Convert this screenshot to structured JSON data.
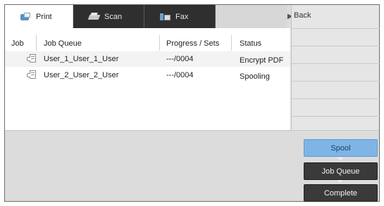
{
  "tabs": [
    {
      "label": "Print",
      "icon": "print-icon",
      "active": true
    },
    {
      "label": "Scan",
      "icon": "scan-icon",
      "active": false
    },
    {
      "label": "Fax",
      "icon": "fax-icon",
      "active": false
    }
  ],
  "side_panel": {
    "back_label": "Back",
    "arrow_icon": "play-arrow-icon"
  },
  "table": {
    "columns": [
      "Job",
      "Job Queue",
      "Progress / Sets",
      "Status"
    ],
    "rows": [
      {
        "icon": "job-document-icon",
        "name": "User_1_User_1_User",
        "progress": "---/0004",
        "status": "Encrypt PDF"
      },
      {
        "icon": "job-document-icon",
        "name": "User_2_User_2_User",
        "progress": "---/0004",
        "status": "Spooling"
      }
    ]
  },
  "flow_buttons": {
    "spool": "Spool",
    "job_queue": "Job Queue",
    "complete": "Complete"
  },
  "colors": {
    "spool_active": "#7fb5e6",
    "dark_button": "#3a3a3a",
    "tab_dark": "#2f2f2f"
  }
}
